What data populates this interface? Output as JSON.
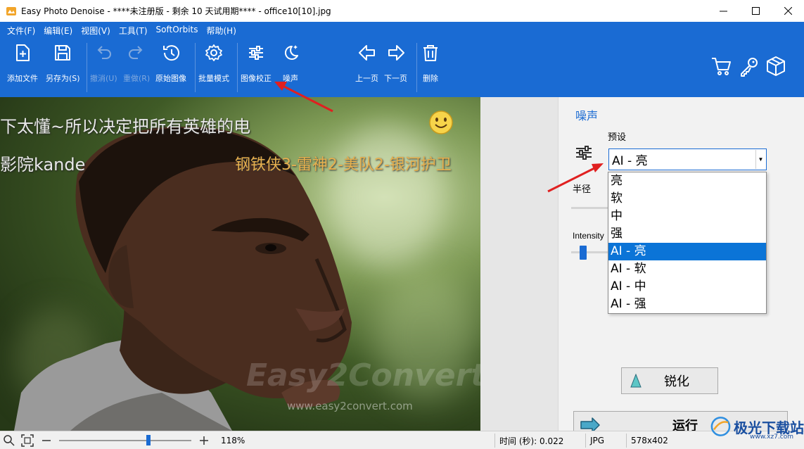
{
  "window": {
    "title": "Easy Photo Denoise - ****未注册版 - 剩余 10 天试用期**** - office10[10].jpg",
    "controls": [
      "minimize",
      "maximize",
      "close"
    ]
  },
  "menu": {
    "file": "文件(F)",
    "edit": "编辑(E)",
    "view": "视图(V)",
    "tools": "工具(T)",
    "softorbits": "SoftOrbits",
    "help": "帮助(H)"
  },
  "toolbar": {
    "add_file": "添加文件",
    "save_as": "另存为(S)",
    "undo": "撤消(U)",
    "redo": "重做(R)",
    "original": "原始图像",
    "batch": "批量模式",
    "correction": "图像校正",
    "noise": "噪声",
    "prev": "上一页",
    "next": "下一页",
    "delete": "删除"
  },
  "image": {
    "overlay_line1": "下太懂~所以决定把所有英雄的电",
    "overlay_line2": "影院kande",
    "overlay_line3": "钢铁侠3-雷神2-美队2-银河护卫",
    "watermark": "Easy2Convert",
    "watermark_url": "www.easy2convert.com"
  },
  "panel": {
    "title": "噪声",
    "preset_label": "预设",
    "preset_value": "AI - 亮",
    "radius_label": "半径",
    "intensity_label": "Intensity",
    "intensity_level": 0.3,
    "options": [
      "亮",
      "软",
      "中",
      "强",
      "AI - 亮",
      "AI - 软",
      "AI - 中",
      "AI - 强"
    ],
    "selected_option": "AI - 亮",
    "sharpen_button": "锐化",
    "run_button": "运行"
  },
  "status": {
    "zoom": "118%",
    "time": "时间 (秒): 0.022",
    "format": "JPG",
    "dimensions": "578x402"
  },
  "brand": {
    "name": "极光下载站",
    "url": "www.xz7.com"
  },
  "colors": {
    "ribbon": "#1a6bd3",
    "accent": "#1a6bd3",
    "selection": "#0b74d7",
    "annotation_arrow": "#e02020"
  }
}
